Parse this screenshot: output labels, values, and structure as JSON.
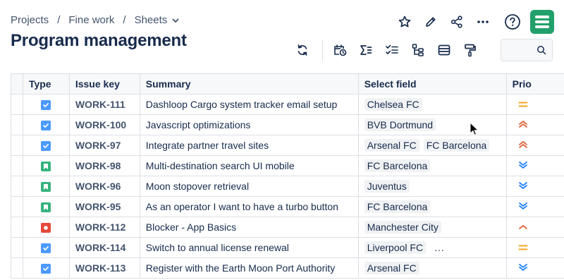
{
  "breadcrumb": {
    "items": [
      "Projects",
      "Fine work",
      "Sheets"
    ],
    "separator": "/"
  },
  "page": {
    "title": "Program management"
  },
  "top_actions": [
    "star-icon",
    "pencil-icon",
    "share-icon",
    "more-icon",
    "help-icon"
  ],
  "toolbar": {
    "buttons": [
      "refresh-icon",
      "schedule-icon",
      "sum-icon",
      "checklist-icon",
      "hierarchy-icon",
      "rows-icon",
      "format-paint-icon"
    ],
    "search_placeholder": ""
  },
  "table": {
    "columns": [
      "Type",
      "Issue key",
      "Summary",
      "Select field",
      "Prio"
    ],
    "rows": [
      {
        "type": "task",
        "key": "WORK-111",
        "summary": "Dashloop Cargo system tracker email setup",
        "select": [
          "Chelsea FC"
        ],
        "more": "",
        "prio": "medium"
      },
      {
        "type": "task",
        "key": "WORK-100",
        "summary": "Javascript optimizations",
        "select": [
          "BVB Dortmund"
        ],
        "more": "",
        "prio": "highest"
      },
      {
        "type": "task",
        "key": "WORK-97",
        "summary": "Integrate partner travel sites",
        "select": [
          "Arsenal FC",
          "FC Barcelona"
        ],
        "more": "",
        "prio": "highest"
      },
      {
        "type": "story",
        "key": "WORK-98",
        "summary": "Multi-destination search UI mobile",
        "select": [
          "FC Barcelona"
        ],
        "more": "",
        "prio": "lowest"
      },
      {
        "type": "story",
        "key": "WORK-96",
        "summary": "Moon stopover retrieval",
        "select": [
          "Juventus"
        ],
        "more": "",
        "prio": "lowest"
      },
      {
        "type": "story",
        "key": "WORK-95",
        "summary": "As an operator I want to have a turbo button",
        "select": [
          "FC Barcelona"
        ],
        "more": "",
        "prio": "lowest"
      },
      {
        "type": "bug",
        "key": "WORK-112",
        "summary": "Blocker - App Basics",
        "select": [
          "Manchester City"
        ],
        "more": "",
        "prio": "high"
      },
      {
        "type": "task",
        "key": "WORK-114",
        "summary": "Switch to annual license renewal",
        "select": [
          "Liverpool FC"
        ],
        "more": "...",
        "prio": "medium"
      },
      {
        "type": "task",
        "key": "WORK-113",
        "summary": "Register with the Earth Moon Port Authority",
        "select": [
          "Arsenal FC"
        ],
        "more": "",
        "prio": "lowest"
      }
    ]
  },
  "colors": {
    "task": "#4c9aff",
    "story": "#36b37e",
    "bug": "#e5493a",
    "prio_medium": "#f5a623",
    "prio_high": "#e2643c",
    "prio_lowest": "#2684ff",
    "brand": "#22a06b"
  }
}
